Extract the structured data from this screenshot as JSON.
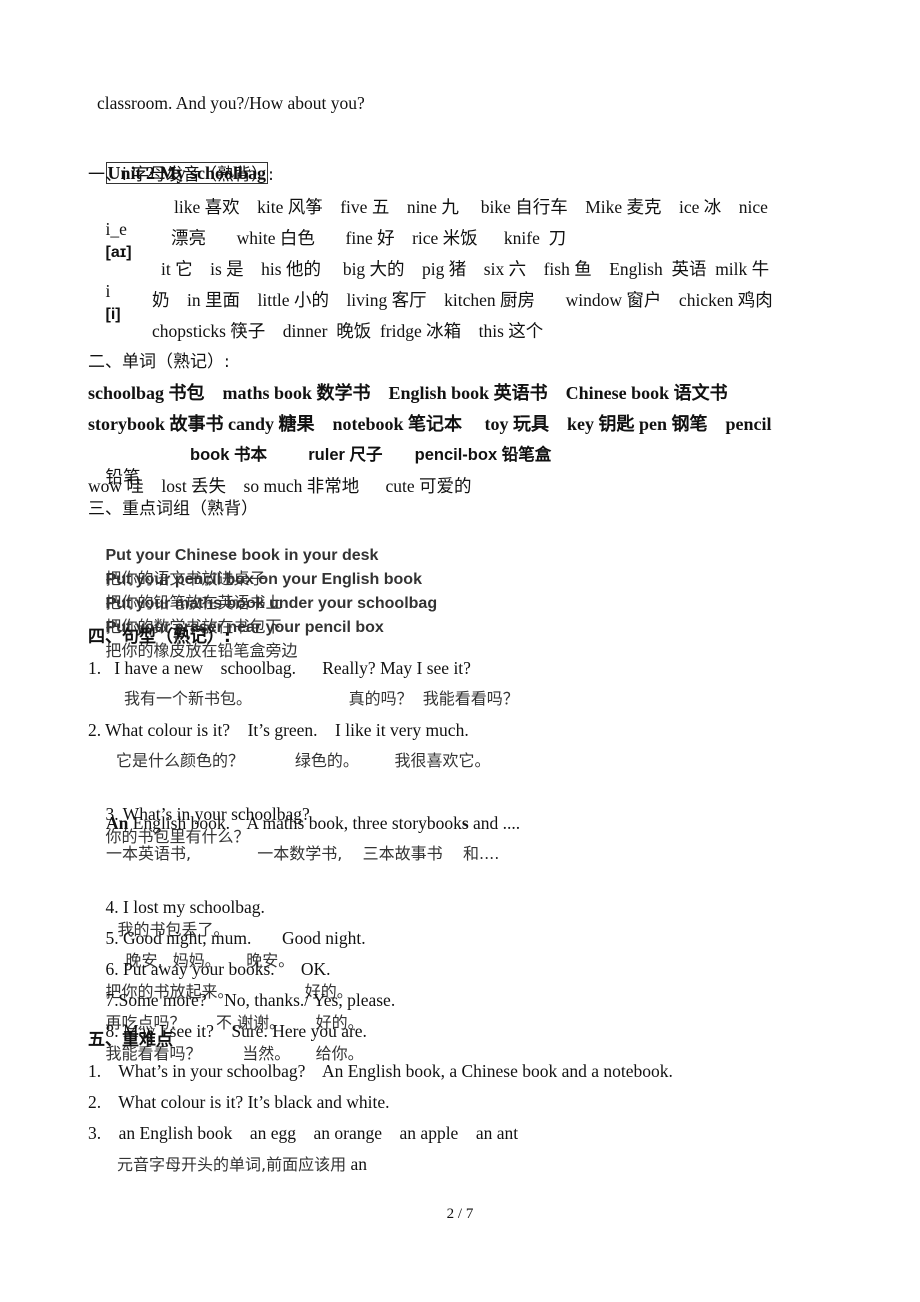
{
  "continuation": "classroom. And you?/How about you?",
  "unit_title": "Unit 2 My schoolbag",
  "sections": {
    "s1": {
      "heading": "一、i 字母发音（熟背）:",
      "ie_label": "i_e",
      "ie_ipa": "[aɪ]",
      "ie_line1": "like 喜欢    kite 风筝    five 五    nine 九     bike 自行车    Mike 麦克    ice 冰    nice",
      "ie_line2": "漂亮       white 白色       fine 好    rice 米饭      knife  刀",
      "i_label": "i",
      "i_ipa": "[i]",
      "i_line1": "it 它    is 是    his 他的     big 大的    pig 猪    six 六    fish 鱼    English  英语  milk 牛",
      "i_line2": "奶    in 里面    little 小的    living 客厅    kitchen 厨房       window 窗户    chicken 鸡肉",
      "i_line3": "chopsticks 筷子    dinner  晚饭  fridge 冰箱    this 这个"
    },
    "s2": {
      "heading": "二、单词（熟记）:",
      "line1": "schoolbag 书包    maths book 数学书    English book 英语书    Chinese book 语文书",
      "line2": "storybook 故事书 candy 糖果    notebook 笔记本     toy 玩具    key 钥匙 pen 钢笔    pencil",
      "line3_a": "铅笔",
      "line3_b": "book 书本         ruler 尺子       pencil-box 铅笔盒",
      "line4": "wow 哇    lost 丢失    so much 非常地      cute 可爱的"
    },
    "s3": {
      "heading": "三、重点词组（熟背）",
      "phrases": [
        {
          "en": "Put your Chinese book in your desk",
          "cn": "把你的语文书放进桌子"
        },
        {
          "en": "Put your pencil box on your English book",
          "cn": "把你的铅笔放在英语书上"
        },
        {
          "en": "Put your maths book under your schoolbag",
          "cn": "把你的数学书放在书包下"
        },
        {
          "en": "Put your eraser near your pencil box",
          "cn": "把你的橡皮放在铅笔盒旁边"
        }
      ]
    },
    "s4": {
      "heading": "四、句型（熟记）:",
      "l1": "1.   I have a new    schoolbag.      Really? May I see it?",
      "l1cn": "我有一个新书包。                   真的吗？  我能看看吗？",
      "l2": "2. What colour is it?    It’s green.    I like it very much.",
      "l2cn": "它是什么颜色的？          绿色的。       我很喜欢它。",
      "l3": "3. What’s in your schoolbag?",
      "l3cn": "你的书包里有什么？",
      "l3a_bold": "An",
      "l3a_rest": " English book.    A maths book, three storybook",
      "l3a_s": "s",
      "l3a_end": " and ....",
      "l3acn": "一本英语书,             一本数学书,    三本故事书    和....",
      "l4": "4. I lost my schoolbag.",
      "l4cn": "我的书包丢了。",
      "l5": "5. Good night, mum.       Good night.",
      "l5cn": "晚安,  妈妈。     晚安。",
      "l6": "6. Put away your books.      OK.",
      "l6cn": "把你的书放起来。              好的。",
      "l7": "7.Some more?    No, thanks./ Yes, please.",
      "l7cn": "再吃点吗？      不,谢谢。      好的。",
      "l8": "8. May I see it?    Sure. Here you are.",
      "l8cn": "我能看看吗？        当然。     给你。"
    },
    "s5": {
      "heading": "五、重难点",
      "items": [
        "1.    What’s in your schoolbag?    An English book, a Chinese book and a notebook.",
        "2.    What colour is it? It’s black and white.",
        "3.    an English book    an egg    an orange    an apple    an ant"
      ],
      "note_cn": "元音字母开头的单词,前面应该用",
      "note_an": " an"
    }
  },
  "footer": {
    "page_indicator": "2 / 7"
  }
}
